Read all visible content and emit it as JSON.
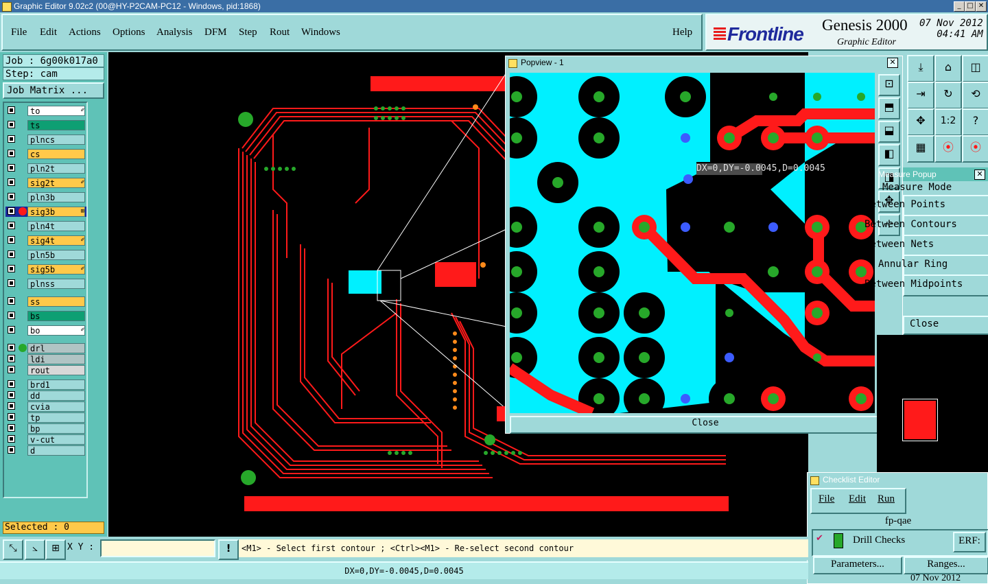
{
  "window": {
    "title": "Graphic Editor 9.02c2 (00@HY-P2CAM-PC12 - Windows, pid:1868)",
    "controls": [
      "_",
      "□",
      "✕"
    ]
  },
  "menu": [
    "File",
    "Edit",
    "Actions",
    "Options",
    "Analysis",
    "DFM",
    "Step",
    "Rout",
    "Windows"
  ],
  "help_label": "Help",
  "logo": {
    "brand": "Frontline",
    "product": "Genesis 2000",
    "module": "Graphic Editor",
    "date": "07 Nov 2012",
    "time": "04:41 AM"
  },
  "job": {
    "job_line": "Job : 6g00k017a0",
    "step_line": "Step: cam",
    "matrix_button": "Job Matrix ..."
  },
  "layers": [
    {
      "name": "to",
      "color": "#ffffff",
      "mark": "✐"
    },
    {
      "name": "ts",
      "color": "#0e9f73",
      "mark": ""
    },
    {
      "name": "plncs",
      "color": "#9fd9d9",
      "mark": ""
    },
    {
      "name": "cs",
      "color": "#ffc94a",
      "mark": ""
    },
    {
      "name": "pln2t",
      "color": "#9fd9d9",
      "mark": ""
    },
    {
      "name": "sig2t",
      "color": "#ffc94a",
      "mark": "✐"
    },
    {
      "name": "pln3b",
      "color": "#9fd9d9",
      "mark": ""
    },
    {
      "name": "sig3b",
      "color": "#ffc94a",
      "mark": "⊞",
      "dot": "#ff1a1a",
      "selected": true
    },
    {
      "name": "pln4t",
      "color": "#9fd9d9",
      "mark": ""
    },
    {
      "name": "sig4t",
      "color": "#ffc94a",
      "mark": "✐"
    },
    {
      "name": "pln5b",
      "color": "#9fd9d9",
      "mark": ""
    },
    {
      "name": "sig5b",
      "color": "#ffc94a",
      "mark": "✐"
    },
    {
      "name": "plnss",
      "color": "#9fd9d9",
      "mark": ""
    },
    {
      "name": "ss",
      "color": "#ffc94a",
      "mark": ""
    },
    {
      "name": "bs",
      "color": "#0e9f73",
      "mark": ""
    },
    {
      "name": "bo",
      "color": "#ffffff",
      "mark": "✐"
    },
    {
      "name": "drl",
      "color": "#b0c4c4",
      "mark": "",
      "dot": "#27a82a"
    },
    {
      "name": "ldi",
      "color": "#b0c4c4",
      "mark": ""
    },
    {
      "name": "rout",
      "color": "#d8d8d8",
      "mark": ""
    },
    {
      "name": "brd1",
      "color": "#9fd9d9",
      "mark": ""
    },
    {
      "name": "dd",
      "color": "#9fd9d9",
      "mark": ""
    },
    {
      "name": "cvia",
      "color": "#9fd9d9",
      "mark": ""
    },
    {
      "name": "tp",
      "color": "#9fd9d9",
      "mark": ""
    },
    {
      "name": "bp",
      "color": "#9fd9d9",
      "mark": ""
    },
    {
      "name": "v-cut",
      "color": "#9fd9d9",
      "mark": ""
    },
    {
      "name": "d",
      "color": "#9fd9d9",
      "mark": ""
    }
  ],
  "selected_label": "Selected : 0",
  "popview": {
    "title": "Popview - 1",
    "measure_readout": "DX=0,DY=-0.0045,D=0.0045",
    "close_label": "Close"
  },
  "measure_popup": {
    "title": "Measure Popup",
    "items": [
      "Measure Mode",
      "Between Points",
      "Between Contours",
      "Between Nets",
      "Annular Ring",
      "Between Midpoints"
    ],
    "close_label": "Close"
  },
  "checklist": {
    "title": "Checklist Editor",
    "menu": [
      "File",
      "Edit",
      "Run"
    ],
    "name": "fp-qae",
    "item_label": "Drill Checks",
    "erf_label": "ERF:",
    "parameters_label": "Parameters...",
    "ranges_label": "Ranges...",
    "date": "07 Nov 2012"
  },
  "bottom": {
    "xy_label": "X Y :",
    "xy_value": "",
    "prompt": "<M1> - Select first contour ; <Ctrl><M1> - Re-select second contour",
    "status": "DX=0,DY=-0.0045,D=0.0045"
  },
  "colors": {
    "panel": "#9fd9d9",
    "trace": "#ff1a1a",
    "copper_plane": "#00f0ff",
    "pad_drill": "#27a82a"
  }
}
